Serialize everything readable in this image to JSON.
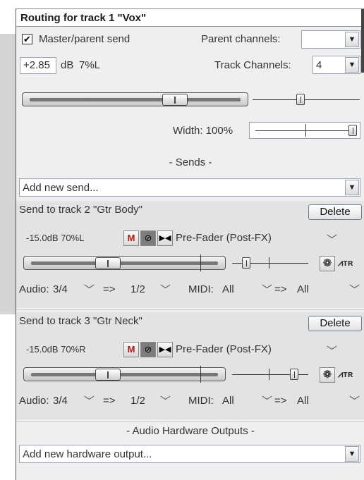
{
  "window": {
    "title": "Routing for track 1 \"Vox\""
  },
  "master": {
    "checkbox_label": "Master/parent send",
    "checked": true,
    "parent_channels_label": "Parent channels:",
    "parent_channels_value": "",
    "volume_value": "+2.85",
    "db_label": "dB",
    "pan_value": "7%L",
    "track_channels_label": "Track Channels:",
    "track_channels_value": "4",
    "volume_fraction": 0.7,
    "pan_fraction": 0.44,
    "width_label": "Width: 100%",
    "width_fraction": 1.0
  },
  "sends": {
    "header": "- Sends -",
    "add_new_placeholder": "Add new send...",
    "delete_label": "Delete",
    "items": [
      {
        "title": "Send to track 2 \"Gtr Body\"",
        "info": "-15.0dB 70%L",
        "mode": "Pre-Fader (Post-FX)",
        "volume_fraction": 0.4,
        "pan_fraction": 0.15,
        "audio_label": "Audio:",
        "audio_src": "3/4",
        "arrow": "=>",
        "audio_dst": "1/2",
        "midi_label": "MIDI:",
        "midi_src": "All",
        "midi_dst": "All"
      },
      {
        "title": "Send to track 3 \"Gtr Neck\"",
        "info": "-15.0dB 70%R",
        "mode": "Pre-Fader (Post-FX)",
        "volume_fraction": 0.4,
        "pan_fraction": 0.85,
        "audio_label": "Audio:",
        "audio_src": "3/4",
        "arrow": "=>",
        "audio_dst": "1/2",
        "midi_label": "MIDI:",
        "midi_src": "All",
        "midi_dst": "All"
      }
    ],
    "mute_label": "M",
    "phase_icon": "phase-invert-icon",
    "mono_icon": "mono-stereo-icon",
    "fx_icon": "fx-circle-icon",
    "trim_icon": "automation-mode-icon"
  },
  "hardware": {
    "header": "- Audio Hardware Outputs -",
    "add_new_placeholder": "Add new hardware output..."
  },
  "colors": {
    "accent_red": "#b01818",
    "panel_bg": "#efefef",
    "send_bg": "#e3e3e3"
  }
}
